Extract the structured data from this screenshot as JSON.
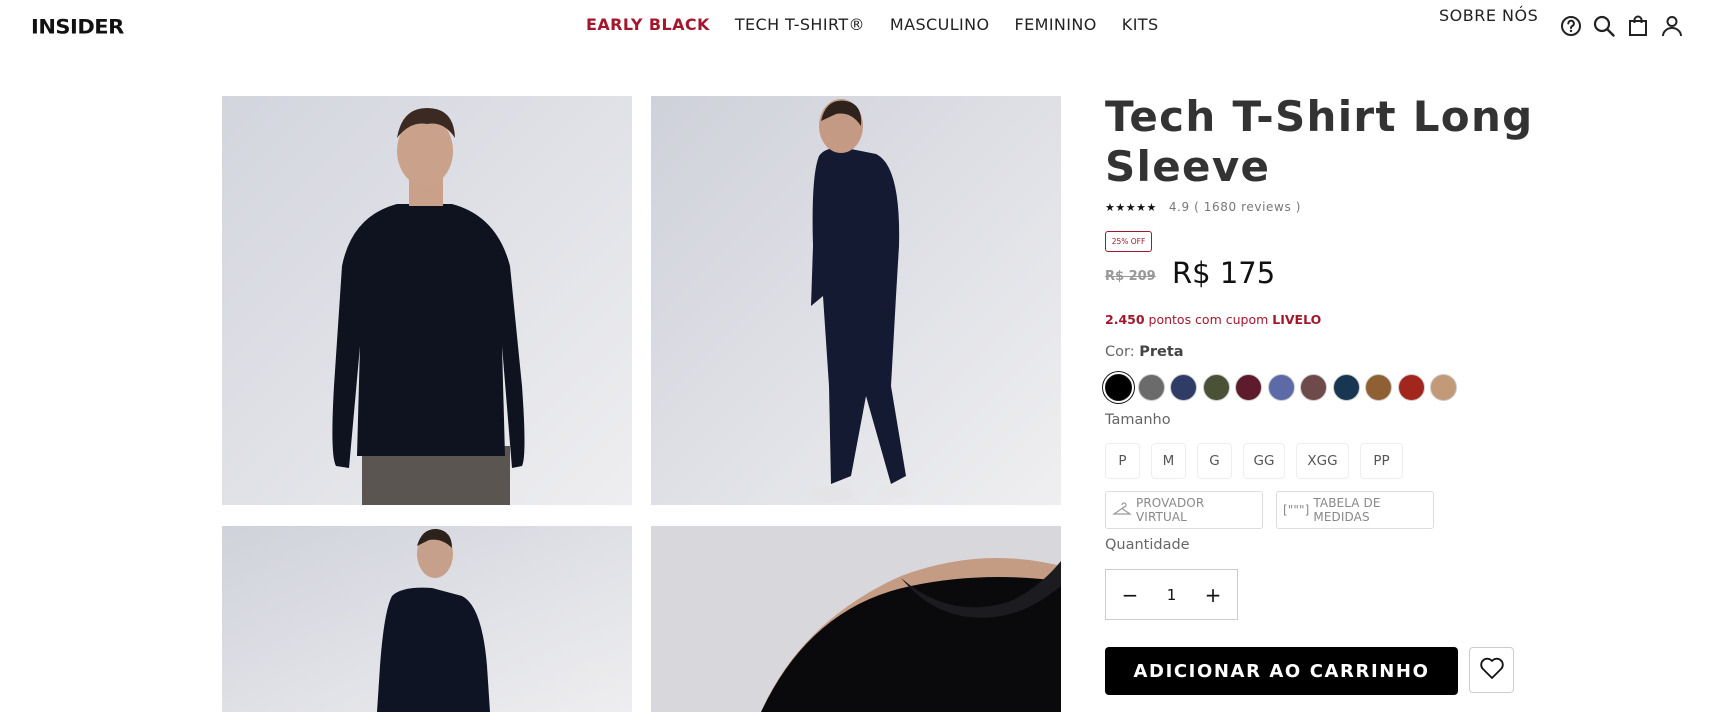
{
  "header": {
    "logo": "INSIDER",
    "nav": [
      {
        "label": "EARLY BLACK",
        "accent": true
      },
      {
        "label": "TECH T-SHIRT®",
        "accent": false
      },
      {
        "label": "MASCULINO",
        "accent": false
      },
      {
        "label": "FEMININO",
        "accent": false
      },
      {
        "label": "KITS",
        "accent": false
      }
    ],
    "about": "SOBRE NÓS",
    "icons": [
      "help-icon",
      "search-icon",
      "bag-icon",
      "user-icon"
    ]
  },
  "gallery": {
    "images": [
      "product-photo-front",
      "product-photo-side",
      "product-photo-walking",
      "product-photo-detail"
    ]
  },
  "product": {
    "title": "Tech T-Shirt Long Sleeve",
    "stars": "★★★★★",
    "rating": "4.9 ( 1680 reviews )",
    "badge": "25% OFF",
    "old_price": "R$ 209",
    "price": "R$ 175",
    "points_value": "2.450",
    "points_text": " pontos com cupom ",
    "points_coupon": "LIVELO",
    "color_label": "Cor: ",
    "color_value": "Preta",
    "size_label": "Tamanho",
    "qty_label": "Quantidade",
    "quantity": "1",
    "qty_minus": "−",
    "qty_plus": "+",
    "add_to_cart": "ADICIONAR AO CARRINHO",
    "virtual_fit": "PROVADOR VIRTUAL",
    "size_chart": "TABELA DE MEDIDAS",
    "size_chart_icon": "[\"\"\"]"
  },
  "colors": [
    "#000000",
    "#6b6b6b",
    "#2f3d66",
    "#4a5136",
    "#5e1b2c",
    "#5d6aa8",
    "#6e4a4a",
    "#173652",
    "#8f6034",
    "#a3261d",
    "#c29a78"
  ],
  "sizes": [
    "P",
    "M",
    "G",
    "GG",
    "XGG",
    "PP"
  ]
}
